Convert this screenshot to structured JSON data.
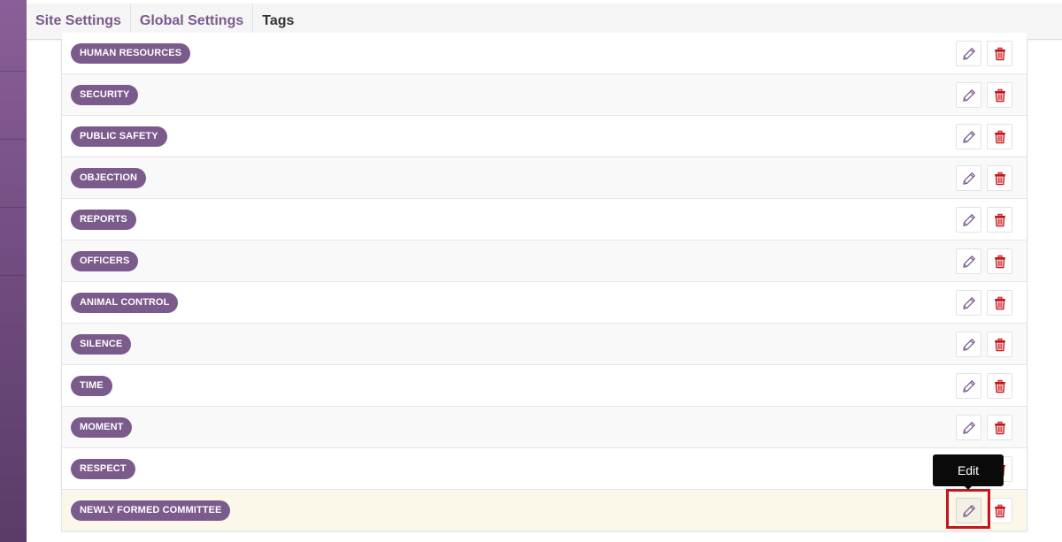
{
  "tabs": [
    {
      "label": "Site Settings"
    },
    {
      "label": "Global Settings"
    },
    {
      "label": "Tags"
    }
  ],
  "tags": [
    {
      "label": "HUMAN RESOURCES"
    },
    {
      "label": "SECURITY"
    },
    {
      "label": "PUBLIC SAFETY"
    },
    {
      "label": "OBJECTION"
    },
    {
      "label": "REPORTS"
    },
    {
      "label": "OFFICERS"
    },
    {
      "label": "ANIMAL CONTROL"
    },
    {
      "label": "SILENCE"
    },
    {
      "label": "TIME"
    },
    {
      "label": "MOMENT"
    },
    {
      "label": "RESPECT"
    },
    {
      "label": "NEWLY FORMED COMMITTEE"
    }
  ],
  "tooltip": {
    "label": "Edit"
  },
  "icons": {
    "edit": "pencil-icon",
    "delete": "trash-icon"
  },
  "colors": {
    "accent": "#7b5a8c",
    "delete": "#c4161c",
    "highlight_row": "#fcf8e9"
  }
}
